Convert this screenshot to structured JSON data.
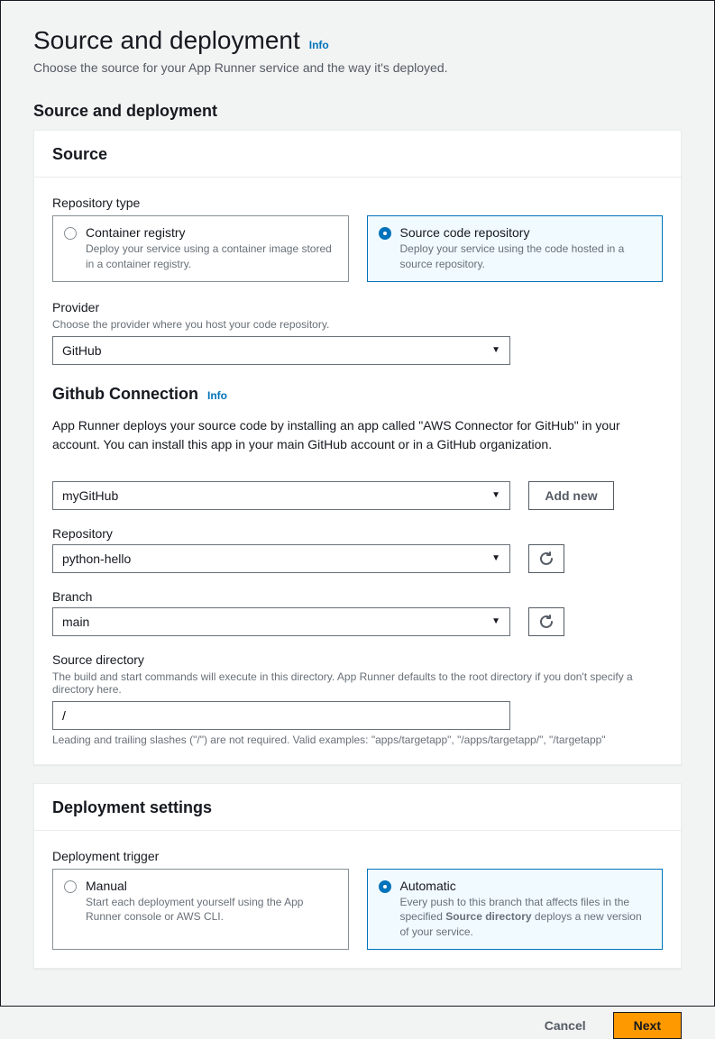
{
  "page": {
    "title": "Source and deployment",
    "info_label": "Info",
    "subtitle": "Choose the source for your App Runner service and the way it's deployed.",
    "section_heading": "Source and deployment"
  },
  "source_card": {
    "header": "Source",
    "repo_type_label": "Repository type",
    "tile_container": {
      "title": "Container registry",
      "desc": "Deploy your service using a container image stored in a container registry."
    },
    "tile_source": {
      "title": "Source code repository",
      "desc": "Deploy your service using the code hosted in a source repository."
    },
    "provider": {
      "label": "Provider",
      "desc": "Choose the provider where you host your code repository.",
      "value": "GitHub"
    },
    "gh_connection": {
      "heading": "Github Connection",
      "info_label": "Info",
      "desc": "App Runner deploys your source code by installing an app called \"AWS Connector for GitHub\" in your account. You can install this app in your main GitHub account or in a GitHub organization."
    },
    "connection_select": {
      "value": "myGitHub",
      "add_new_label": "Add new"
    },
    "repository": {
      "label": "Repository",
      "value": "python-hello"
    },
    "branch": {
      "label": "Branch",
      "value": "main"
    },
    "source_dir": {
      "label": "Source directory",
      "desc": "The build and start commands will execute in this directory. App Runner defaults to the root directory if you don't specify a directory here.",
      "value": "/",
      "help": "Leading and trailing slashes (\"/\") are not required. Valid examples: \"apps/targetapp\", \"/apps/targetapp/\", \"/targetapp\""
    }
  },
  "deploy_card": {
    "header": "Deployment settings",
    "trigger_label": "Deployment trigger",
    "tile_manual": {
      "title": "Manual",
      "desc": "Start each deployment yourself using the App Runner console or AWS CLI."
    },
    "tile_auto": {
      "title": "Automatic",
      "desc_pre": "Every push to this branch that affects files in the specified ",
      "desc_bold": "Source directory",
      "desc_post": " deploys a new version of your service."
    }
  },
  "footer": {
    "cancel": "Cancel",
    "next": "Next"
  }
}
